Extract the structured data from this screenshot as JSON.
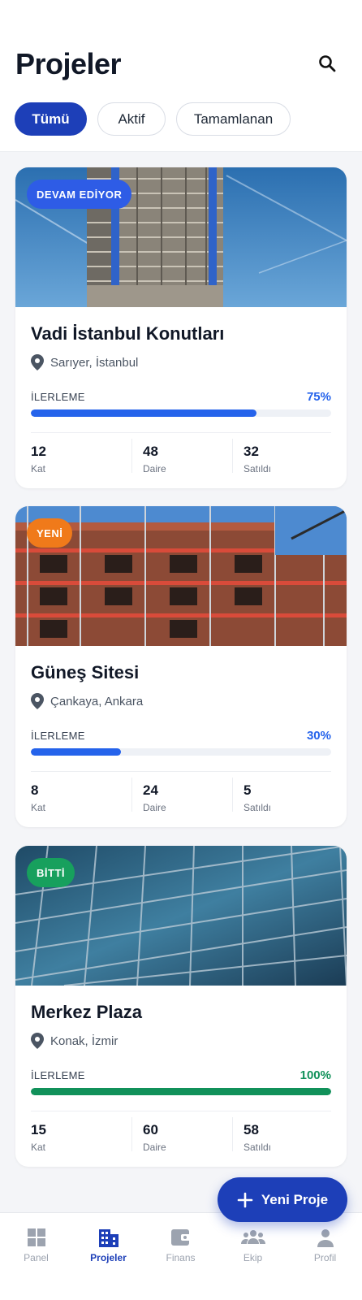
{
  "header": {
    "title": "Projeler",
    "filters": [
      "Tümü",
      "Aktif",
      "Tamamlanan"
    ],
    "active_filter": "Tümü"
  },
  "projects": [
    {
      "badge": "DEVAM EDİYOR",
      "badge_color": "#2e5ce6",
      "name": "Vadi İstanbul Konutları",
      "location": "Sarıyer, İstanbul",
      "progress_label": "İLERLEME",
      "progress": 75,
      "progress_text": "75%",
      "progress_color": "#2563eb",
      "stats": [
        {
          "value": "12",
          "label": "Kat"
        },
        {
          "value": "48",
          "label": "Daire"
        },
        {
          "value": "32",
          "label": "Satıldı"
        }
      ]
    },
    {
      "badge": "YENİ",
      "badge_color": "#f07a1a",
      "name": "Güneş Sitesi",
      "location": "Çankaya, Ankara",
      "progress_label": "İLERLEME",
      "progress": 30,
      "progress_text": "30%",
      "progress_color": "#2563eb",
      "stats": [
        {
          "value": "8",
          "label": "Kat"
        },
        {
          "value": "24",
          "label": "Daire"
        },
        {
          "value": "5",
          "label": "Satıldı"
        }
      ]
    },
    {
      "badge": "BİTTİ",
      "badge_color": "#17a05d",
      "name": "Merkez Plaza",
      "location": "Konak, İzmir",
      "progress_label": "İLERLEME",
      "progress": 100,
      "progress_text": "100%",
      "progress_color": "#11915a",
      "stats": [
        {
          "value": "15",
          "label": "Kat"
        },
        {
          "value": "60",
          "label": "Daire"
        },
        {
          "value": "58",
          "label": "Satıldı"
        }
      ]
    }
  ],
  "fab": {
    "label": "Yeni Proje",
    "icon": "plus-icon"
  },
  "tabbar": {
    "items": [
      {
        "label": "Panel",
        "icon": "grid-icon"
      },
      {
        "label": "Projeler",
        "icon": "building-icon"
      },
      {
        "label": "Finans",
        "icon": "wallet-icon"
      },
      {
        "label": "Ekip",
        "icon": "team-icon"
      },
      {
        "label": "Profil",
        "icon": "person-icon"
      }
    ],
    "active": "Projeler"
  },
  "colors": {
    "accent": "#1d3fb8",
    "progress_blue": "#2563eb",
    "progress_green": "#11915a"
  }
}
